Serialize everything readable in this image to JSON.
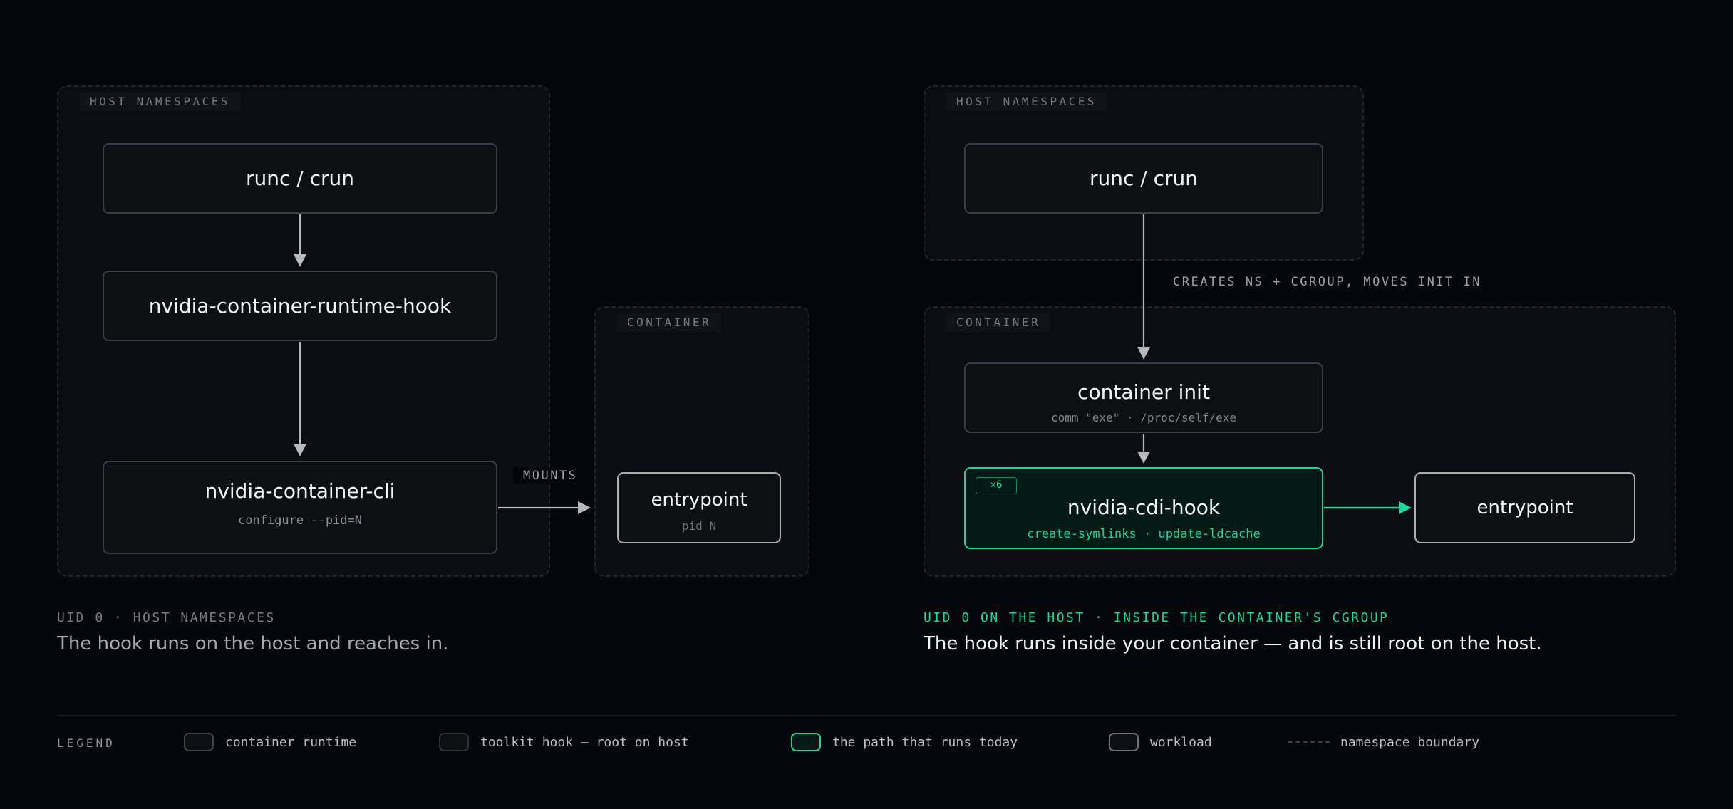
{
  "colors": {
    "background": "#05070c",
    "accent_green": "#20d49a",
    "arrow_gray": "#b4b8c0",
    "dashed_border": "#222633"
  },
  "left_panel": {
    "host_ns_label": "HOST NAMESPACES",
    "runtime_box": {
      "title": "runc / crun"
    },
    "hook_box": {
      "title": "nvidia-container-runtime-hook"
    },
    "cli_box": {
      "title": "nvidia-container-cli",
      "subtitle": "configure --pid=N"
    },
    "mounts_label": "MOUNTS",
    "container_ns_label": "CONTAINER",
    "entrypoint_box": {
      "title": "entrypoint",
      "subtitle": "pid N"
    },
    "caption_tag": "UID 0 · HOST NAMESPACES",
    "caption_text": "The hook runs on the host and reaches in."
  },
  "right_panel": {
    "host_ns_label": "HOST NAMESPACES",
    "runtime_box": {
      "title": "runc / crun"
    },
    "creates_label": "CREATES NS + CGROUP, MOVES INIT IN",
    "container_ns_label": "CONTAINER",
    "init_box": {
      "title": "container init",
      "subtitle": "comm \"exe\" · /proc/self/exe"
    },
    "cdi_box": {
      "badge": "×6",
      "title": "nvidia-cdi-hook",
      "subtitle": "create-symlinks · update-ldcache"
    },
    "entrypoint_box": {
      "title": "entrypoint"
    },
    "caption_tag": "UID 0 ON THE HOST · INSIDE THE CONTAINER'S CGROUP",
    "caption_text": "The hook runs inside your container — and is still root on the host."
  },
  "legend": {
    "label": "LEGEND",
    "items": [
      {
        "text": "container runtime"
      },
      {
        "text": "toolkit hook — root on host"
      },
      {
        "text": "the path that runs today"
      },
      {
        "text": "workload"
      },
      {
        "text": "namespace boundary"
      }
    ]
  }
}
